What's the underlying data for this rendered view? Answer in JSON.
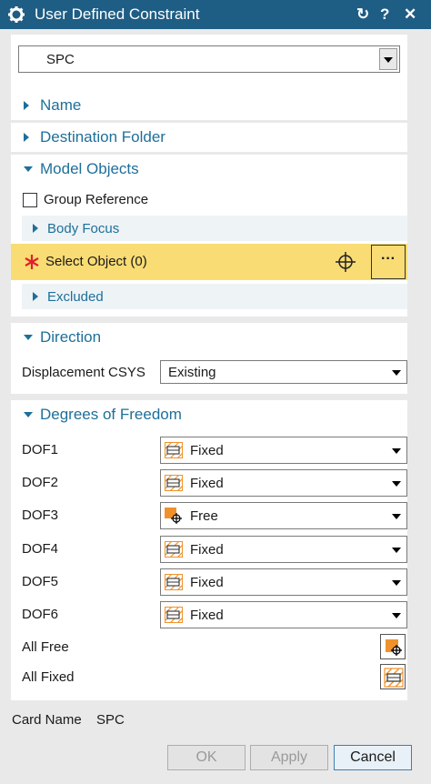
{
  "title": "User Defined Constraint",
  "header_icons": {
    "reset": "↻",
    "help": "?",
    "close": "✕"
  },
  "type_select": {
    "value": "SPC"
  },
  "sections": {
    "name": "Name",
    "destination_folder": "Destination Folder",
    "model_objects": "Model Objects",
    "direction": "Direction",
    "dof": "Degrees of Freedom"
  },
  "model_objects": {
    "group_reference": "Group Reference",
    "body_focus": "Body Focus",
    "select_object": "Select Object (0)",
    "excluded": "Excluded",
    "more": "···"
  },
  "direction": {
    "label": "Displacement CSYS",
    "value": "Existing"
  },
  "dof_rows": [
    {
      "label": "DOF1",
      "value": "Fixed",
      "icon": "fixed-icon"
    },
    {
      "label": "DOF2",
      "value": "Fixed",
      "icon": "fixed-icon"
    },
    {
      "label": "DOF3",
      "value": "Free",
      "icon": "free-icon"
    },
    {
      "label": "DOF4",
      "value": "Fixed",
      "icon": "fixed-icon"
    },
    {
      "label": "DOF5",
      "value": "Fixed",
      "icon": "fixed-icon"
    },
    {
      "label": "DOF6",
      "value": "Fixed",
      "icon": "fixed-icon"
    }
  ],
  "all_free": "All Free",
  "all_fixed": "All Fixed",
  "card": {
    "label": "Card Name",
    "value": "SPC"
  },
  "buttons": {
    "ok": "OK",
    "apply": "Apply",
    "cancel": "Cancel"
  },
  "colors": {
    "titlebar": "#1e5d84",
    "accent": "#1e6f99",
    "highlight": "#f9dc74",
    "required": "#e0202a"
  }
}
